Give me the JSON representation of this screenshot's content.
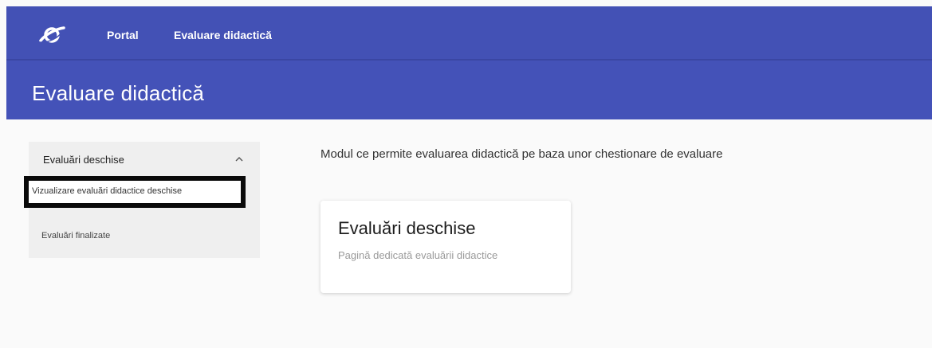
{
  "header": {
    "logo_icon": "planet-ring-icon",
    "nav": {
      "portal_label": "Portal",
      "evaluare_label": "Evaluare didactică"
    }
  },
  "title_bar": {
    "title": "Evaluare didactică"
  },
  "sidebar": {
    "group_label": "Evaluări deschise",
    "group_icon": "chevron-up-icon",
    "items": [
      {
        "label": "Vizualizare evaluări didactice deschise",
        "active": true
      },
      {
        "label": "Evaluări finalizate",
        "active": false
      }
    ]
  },
  "main": {
    "description": "Modul ce permite evaluarea didactică pe baza unor chestionare de evaluare",
    "card": {
      "title": "Evaluări deschise",
      "subtitle": "Pagină dedicată evaluării didactice"
    }
  },
  "colors": {
    "header_bg": "#4351b5",
    "title_bg": "#4452b8",
    "page_bg": "#fafafa",
    "sidebar_bg": "#efefef"
  }
}
